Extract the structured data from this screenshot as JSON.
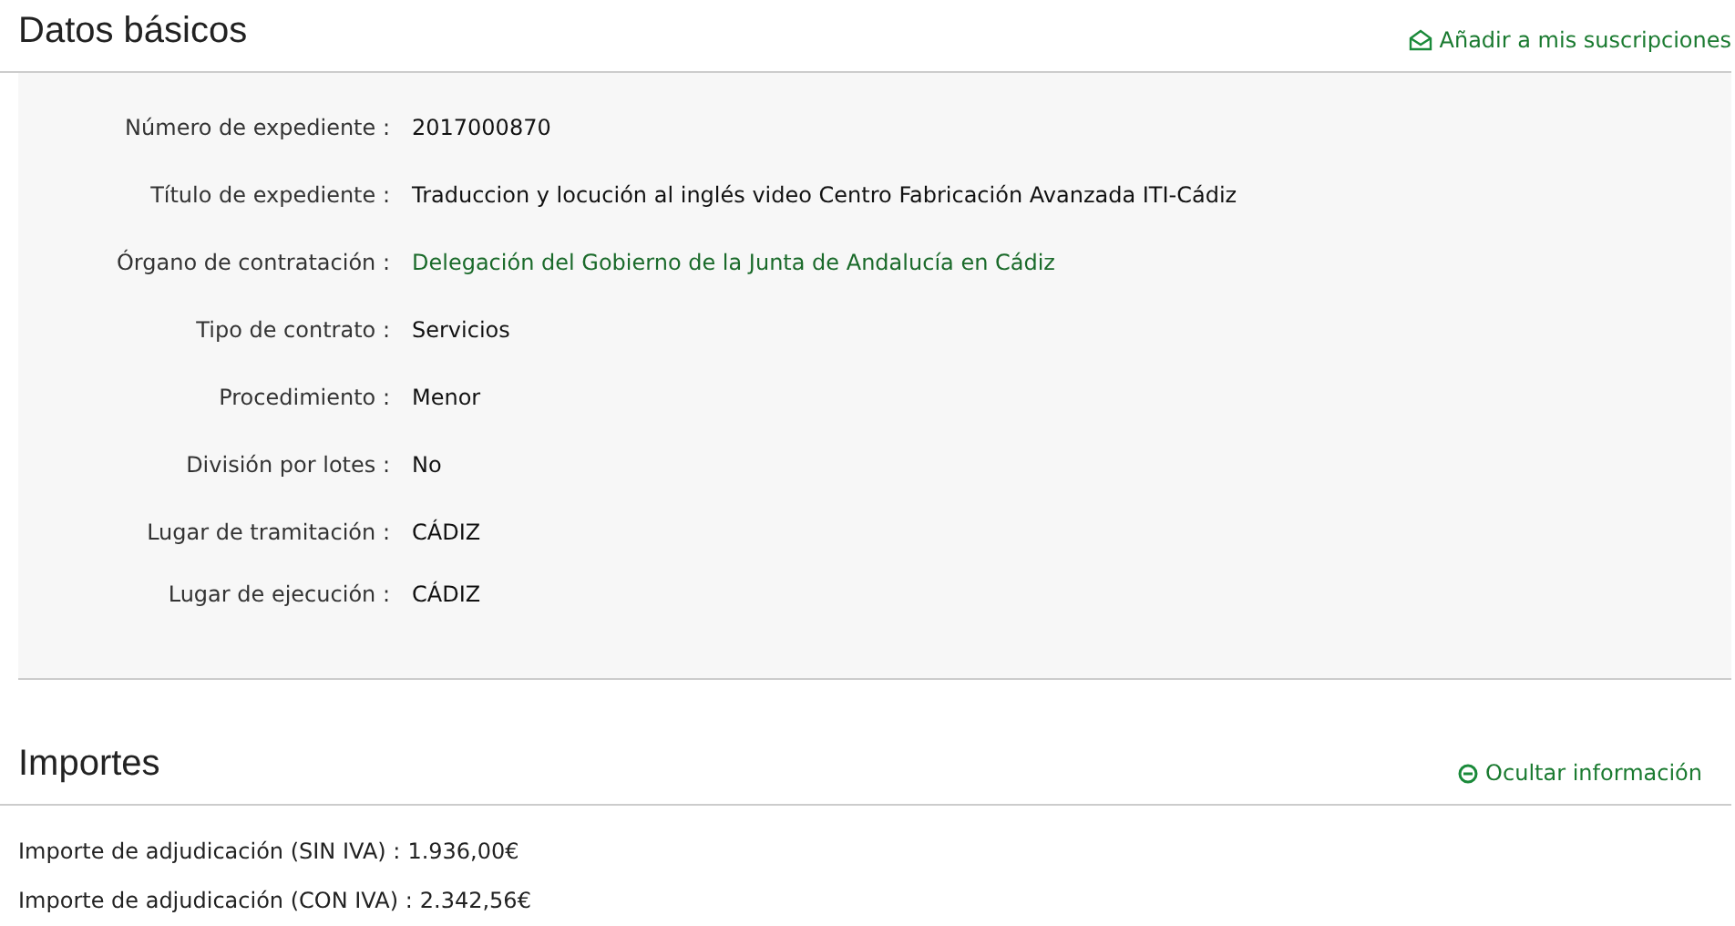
{
  "basic": {
    "title": "Datos básicos",
    "action": {
      "kind": "subscribe",
      "label": "Añadir a mis suscripciones"
    },
    "fields": [
      {
        "label": "Número de expediente :",
        "value": "2017000870",
        "kind": "text"
      },
      {
        "label": "Título de expediente :",
        "value": "Traduccion y locución al inglés video Centro Fabricación Avanzada ITI-Cádiz",
        "kind": "text"
      },
      {
        "label": "Órgano de contratación :",
        "value": "Delegación del Gobierno de la Junta de Andalucía en Cádiz",
        "kind": "link"
      },
      {
        "label": "Tipo de contrato :",
        "value": "Servicios",
        "kind": "text"
      },
      {
        "label": "Procedimiento :",
        "value": "Menor",
        "kind": "text"
      },
      {
        "label": "División por lotes :",
        "value": "No",
        "kind": "text"
      },
      {
        "label": "Lugar de tramitación :",
        "value": "CÁDIZ",
        "kind": "text"
      },
      {
        "label": "Lugar de ejecución :",
        "value": "CÁDIZ",
        "kind": "text"
      }
    ]
  },
  "amounts": {
    "title": "Importes",
    "action": {
      "kind": "collapse",
      "label": "Ocultar información"
    },
    "lines": [
      {
        "label": "Importe de adjudicación (SIN IVA) :",
        "value": "1.936,00€"
      },
      {
        "label": "Importe de adjudicación (CON IVA) :",
        "value": "2.342,56€"
      }
    ]
  }
}
